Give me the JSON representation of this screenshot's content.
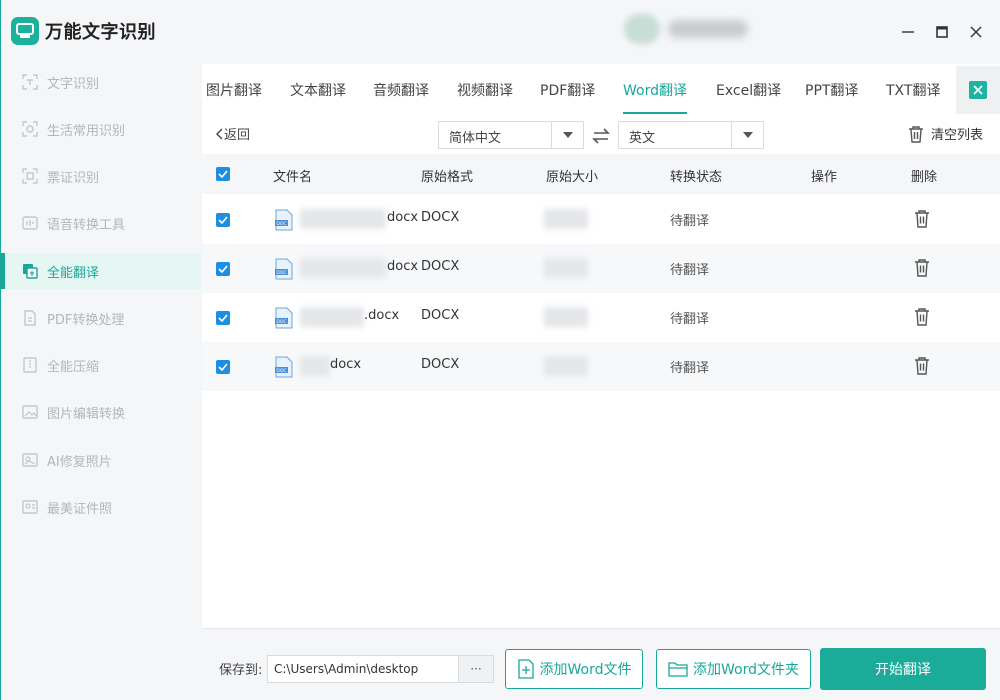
{
  "app": {
    "title": "万能文字识别"
  },
  "sidebar": {
    "items": [
      {
        "label": "文字识别",
        "icon": "text-scan-icon"
      },
      {
        "label": "生活常用识别",
        "icon": "life-scan-icon"
      },
      {
        "label": "票证识别",
        "icon": "ticket-scan-icon"
      },
      {
        "label": "语音转换工具",
        "icon": "voice-icon"
      },
      {
        "label": "全能翻译",
        "icon": "translate-icon",
        "active": true
      },
      {
        "label": "PDF转换处理",
        "icon": "pdf-icon"
      },
      {
        "label": "全能压缩",
        "icon": "compress-icon"
      },
      {
        "label": "图片编辑转换",
        "icon": "image-edit-icon"
      },
      {
        "label": "AI修复照片",
        "icon": "ai-repair-icon"
      },
      {
        "label": "最美证件照",
        "icon": "id-photo-icon"
      }
    ]
  },
  "tabs": [
    {
      "label": "图片翻译"
    },
    {
      "label": "文本翻译"
    },
    {
      "label": "音频翻译"
    },
    {
      "label": "视频翻译"
    },
    {
      "label": "PDF翻译"
    },
    {
      "label": "Word翻译",
      "active": true
    },
    {
      "label": "Excel翻译"
    },
    {
      "label": "PPT翻译"
    },
    {
      "label": "TXT翻译"
    }
  ],
  "toolbar": {
    "back": "返回",
    "source_lang": "简体中文",
    "target_lang": "英文",
    "clear": "清空列表"
  },
  "table": {
    "headers": {
      "name": "文件名",
      "format": "原始格式",
      "size": "原始大小",
      "status": "转换状态",
      "action": "操作",
      "delete": "删除"
    },
    "rows": [
      {
        "name_suffix": "docx",
        "format": "DOCX",
        "status": "待翻译",
        "checked": true
      },
      {
        "name_suffix": "docx",
        "format": "DOCX",
        "status": "待翻译",
        "checked": true
      },
      {
        "name_suffix": ".docx",
        "format": "DOCX",
        "status": "待翻译",
        "checked": true
      },
      {
        "name_suffix": "docx",
        "format": "DOCX",
        "status": "待翻译",
        "checked": true
      }
    ]
  },
  "bottom": {
    "save_label": "保存到:",
    "save_path": "C:\\Users\\Admin\\desktop",
    "browse": "···",
    "add_file": "添加Word文件",
    "add_folder": "添加Word文件夹",
    "start": "开始翻译"
  },
  "colors": {
    "accent": "#17a89a",
    "checkbox": "#1e8fe0"
  }
}
